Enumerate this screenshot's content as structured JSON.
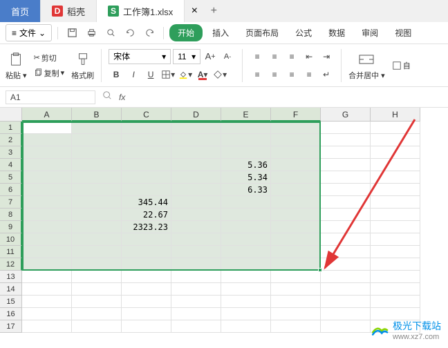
{
  "tabs": {
    "home": "首页",
    "dao": "稻壳",
    "doc": "工作簿1.xlsx"
  },
  "menubar": {
    "file": "文件",
    "start": "开始",
    "insert": "插入",
    "page_layout": "页面布局",
    "formula": "公式",
    "data": "数据",
    "review": "审阅",
    "view": "视图"
  },
  "toolbar": {
    "cut": "剪切",
    "copy": "复制",
    "paste": "粘贴",
    "format_paint": "格式刷",
    "font_name": "宋体",
    "font_size": "11",
    "merge": "合并居中",
    "auto": "自"
  },
  "namebox": "A1",
  "columns": [
    "A",
    "B",
    "C",
    "D",
    "E",
    "F",
    "G",
    "H"
  ],
  "cells": {
    "E4": "5.36",
    "E5": "5.34",
    "E6": "6.33",
    "C7": "345.44",
    "C8": "22.67",
    "C9": "2323.23"
  },
  "watermark": {
    "name": "极光下载站",
    "url": "www.xz7.com"
  }
}
